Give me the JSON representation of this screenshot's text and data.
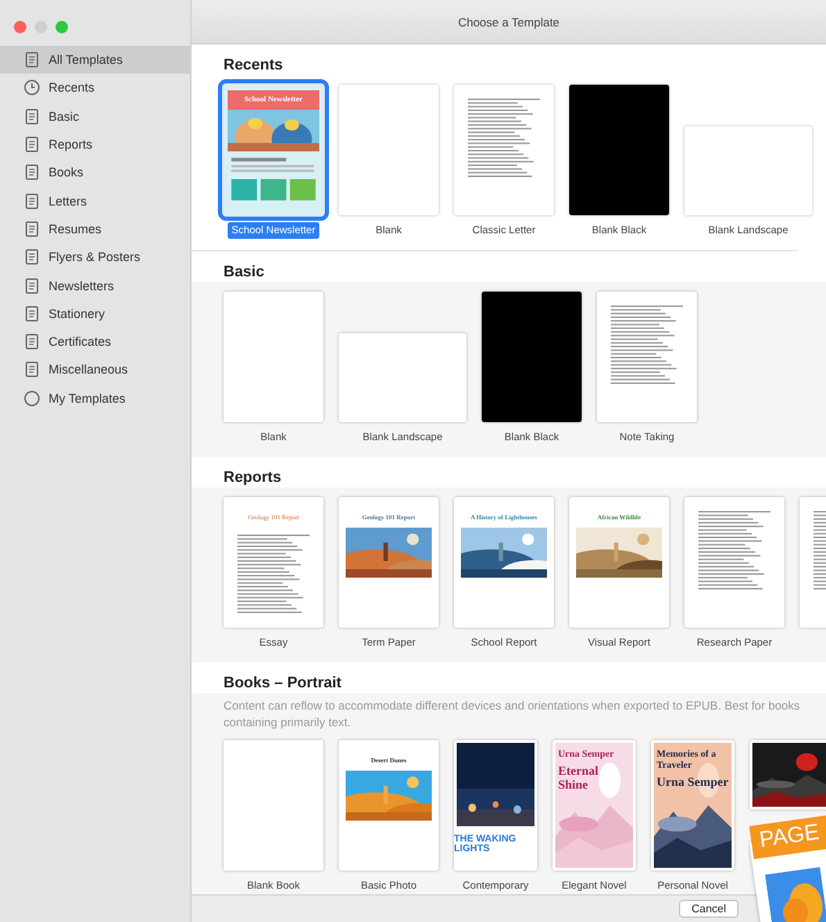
{
  "window": {
    "title": "Choose a Template"
  },
  "sidebar": {
    "items": [
      {
        "label": "All Templates",
        "selected": true
      },
      {
        "label": "Recents",
        "selected": false
      },
      {
        "label": "Basic",
        "selected": false
      },
      {
        "label": "Reports",
        "selected": false
      },
      {
        "label": "Books",
        "selected": false
      },
      {
        "label": "Letters",
        "selected": false
      },
      {
        "label": "Resumes",
        "selected": false
      },
      {
        "label": "Flyers & Posters",
        "selected": false
      },
      {
        "label": "Newsletters",
        "selected": false
      },
      {
        "label": "Stationery",
        "selected": false
      },
      {
        "label": "Certificates",
        "selected": false
      },
      {
        "label": "Miscellaneous",
        "selected": false
      },
      {
        "label": "My Templates",
        "selected": false
      }
    ]
  },
  "sections": [
    {
      "heading": "Recents",
      "templates": [
        {
          "kind": "newsletter",
          "title": "School Newsletter",
          "label": "School Newsletter",
          "selected": true
        },
        {
          "kind": "blank",
          "label": "Blank",
          "selected": false
        },
        {
          "kind": "doc",
          "label": "Classic Letter",
          "selected": false
        },
        {
          "kind": "black",
          "label": "Blank Black",
          "selected": false
        },
        {
          "kind": "landscape",
          "label": "Blank Landscape",
          "selected": false
        }
      ]
    },
    {
      "heading": "Basic",
      "templates": [
        {
          "kind": "blank",
          "label": "Blank",
          "selected": false
        },
        {
          "kind": "landscape",
          "label": "Blank Landscape",
          "selected": false
        },
        {
          "kind": "black",
          "label": "Blank Black",
          "selected": false
        },
        {
          "kind": "doc",
          "label": "Note Taking",
          "selected": false
        }
      ]
    },
    {
      "heading": "Reports",
      "templates": [
        {
          "kind": "doc",
          "title": "Geology 101 Report",
          "label": "Essay",
          "selected": false
        },
        {
          "title": "Geology 101 Report",
          "label": "Term Paper",
          "selected": false
        },
        {
          "title": "A History of Lighthouses",
          "label": "School Report",
          "selected": false
        },
        {
          "title": "African Wildlife",
          "label": "Visual Report",
          "selected": false
        },
        {
          "kind": "doc",
          "label": "Research Paper",
          "selected": false
        },
        {
          "kind": "doc",
          "selected": false
        }
      ]
    },
    {
      "heading": "Books – Portrait",
      "description": "Content can reflow to accommodate different devices and orientations when exported to EPUB. Best for books containing primarily text.",
      "templates": [
        {
          "kind": "blank",
          "label": "Blank Book",
          "selected": false
        },
        {
          "title": "Desert Dunes",
          "label": "Basic Photo",
          "selected": false
        },
        {
          "kind": "photo-under",
          "title": "THE WAKING LIGHTS",
          "label": "Contemporary",
          "selected": false
        },
        {
          "kind": "cover",
          "texts": [
            "Urna Semper",
            "Eternal Shine"
          ],
          "label": "Elegant Novel",
          "selected": false
        },
        {
          "kind": "cover",
          "texts": [
            "Memories of a Traveler",
            "Urna Semper"
          ],
          "label": "Personal Novel",
          "selected": false
        },
        {
          "kind": "cover",
          "selected": false
        }
      ]
    }
  ],
  "footer": {
    "cancel": "Cancel"
  },
  "app_icon": {
    "label": "PAGE"
  }
}
